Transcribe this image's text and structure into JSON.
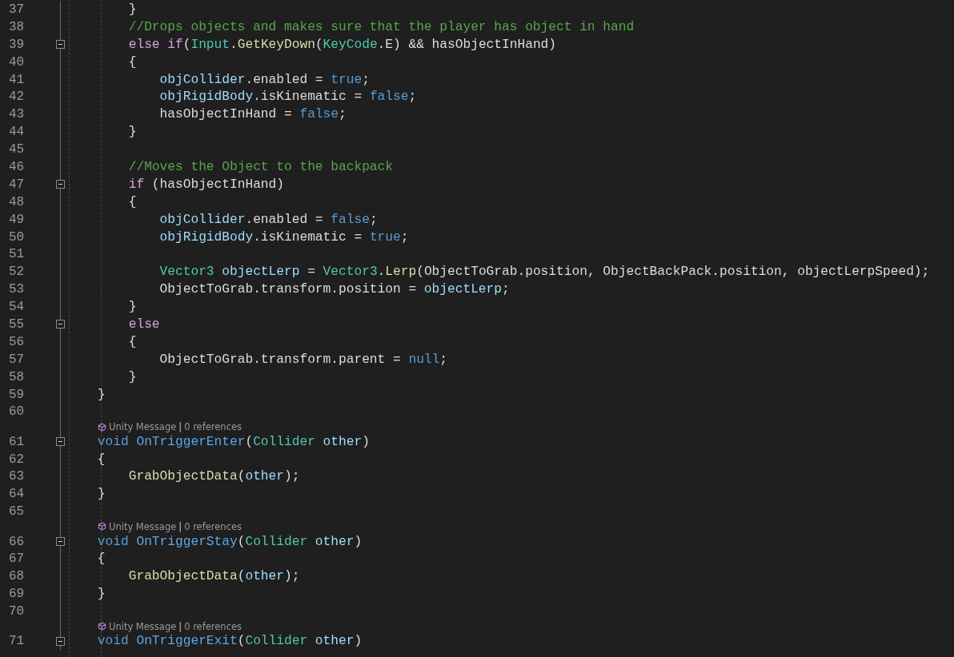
{
  "editor": {
    "lines": [
      {
        "kind": "code",
        "number": "37",
        "foldable": false,
        "tokens": [
          {
            "kind": "plain",
            "text": "        }"
          }
        ]
      },
      {
        "kind": "code",
        "number": "38",
        "foldable": false,
        "tokens": [
          {
            "kind": "comment",
            "text": "        //Drops objects and makes sure that the player has object in hand"
          }
        ]
      },
      {
        "kind": "code",
        "number": "39",
        "foldable": true,
        "tokens": [
          {
            "kind": "keyword",
            "text": "        else if"
          },
          {
            "kind": "plain",
            "text": "("
          },
          {
            "kind": "type",
            "text": "Input"
          },
          {
            "kind": "plain",
            "text": "."
          },
          {
            "kind": "method",
            "text": "GetKeyDown"
          },
          {
            "kind": "plain",
            "text": "("
          },
          {
            "kind": "type",
            "text": "KeyCode"
          },
          {
            "kind": "plain",
            "text": ".E) && hasObjectInHand)"
          }
        ]
      },
      {
        "kind": "code",
        "number": "40",
        "foldable": false,
        "tokens": [
          {
            "kind": "plain",
            "text": "        {"
          }
        ]
      },
      {
        "kind": "code",
        "number": "41",
        "foldable": false,
        "tokens": [
          {
            "kind": "local",
            "text": "            objCollider"
          },
          {
            "kind": "plain",
            "text": ".enabled = "
          },
          {
            "kind": "storage",
            "text": "true"
          },
          {
            "kind": "plain",
            "text": ";"
          }
        ]
      },
      {
        "kind": "code",
        "number": "42",
        "foldable": false,
        "tokens": [
          {
            "kind": "local",
            "text": "            objRigidBody"
          },
          {
            "kind": "plain",
            "text": ".isKinematic = "
          },
          {
            "kind": "storage",
            "text": "false"
          },
          {
            "kind": "plain",
            "text": ";"
          }
        ]
      },
      {
        "kind": "code",
        "number": "43",
        "foldable": false,
        "tokens": [
          {
            "kind": "plain",
            "text": "            hasObjectInHand = "
          },
          {
            "kind": "storage",
            "text": "false"
          },
          {
            "kind": "plain",
            "text": ";"
          }
        ]
      },
      {
        "kind": "code",
        "number": "44",
        "foldable": false,
        "tokens": [
          {
            "kind": "plain",
            "text": "        }"
          }
        ]
      },
      {
        "kind": "code",
        "number": "45",
        "foldable": false
      },
      {
        "kind": "code",
        "number": "46",
        "foldable": false,
        "tokens": [
          {
            "kind": "comment",
            "text": "        //Moves the Object to the backpack"
          }
        ]
      },
      {
        "kind": "code",
        "number": "47",
        "foldable": true,
        "tokens": [
          {
            "kind": "keyword",
            "text": "        if"
          },
          {
            "kind": "plain",
            "text": " (hasObjectInHand)"
          }
        ]
      },
      {
        "kind": "code",
        "number": "48",
        "foldable": false,
        "tokens": [
          {
            "kind": "plain",
            "text": "        {"
          }
        ]
      },
      {
        "kind": "code",
        "number": "49",
        "foldable": false,
        "tokens": [
          {
            "kind": "local",
            "text": "            objCollider"
          },
          {
            "kind": "plain",
            "text": ".enabled = "
          },
          {
            "kind": "storage",
            "text": "false"
          },
          {
            "kind": "plain",
            "text": ";"
          }
        ]
      },
      {
        "kind": "code",
        "number": "50",
        "foldable": false,
        "tokens": [
          {
            "kind": "local",
            "text": "            objRigidBody"
          },
          {
            "kind": "plain",
            "text": ".isKinematic = "
          },
          {
            "kind": "storage",
            "text": "true"
          },
          {
            "kind": "plain",
            "text": ";"
          }
        ]
      },
      {
        "kind": "code",
        "number": "51",
        "foldable": false
      },
      {
        "kind": "code",
        "number": "52",
        "foldable": false,
        "tokens": [
          {
            "kind": "type",
            "text": "            Vector3"
          },
          {
            "kind": "local",
            "text": " objectLerp"
          },
          {
            "kind": "plain",
            "text": " = "
          },
          {
            "kind": "type",
            "text": "Vector3"
          },
          {
            "kind": "plain",
            "text": "."
          },
          {
            "kind": "method",
            "text": "Lerp"
          },
          {
            "kind": "plain",
            "text": "(ObjectToGrab.position, ObjectBackPack.position, objectLerpSpeed);"
          }
        ]
      },
      {
        "kind": "code",
        "number": "53",
        "foldable": false,
        "tokens": [
          {
            "kind": "plain",
            "text": "            ObjectToGrab.transform.position = "
          },
          {
            "kind": "local",
            "text": "objectLerp"
          },
          {
            "kind": "plain",
            "text": ";"
          }
        ]
      },
      {
        "kind": "code",
        "number": "54",
        "foldable": false,
        "tokens": [
          {
            "kind": "plain",
            "text": "        }"
          }
        ]
      },
      {
        "kind": "code",
        "number": "55",
        "foldable": true,
        "tokens": [
          {
            "kind": "keyword",
            "text": "        else"
          }
        ]
      },
      {
        "kind": "code",
        "number": "56",
        "foldable": false,
        "tokens": [
          {
            "kind": "plain",
            "text": "        {"
          }
        ]
      },
      {
        "kind": "code",
        "number": "57",
        "foldable": false,
        "tokens": [
          {
            "kind": "plain",
            "text": "            ObjectToGrab.transform.parent = "
          },
          {
            "kind": "storage",
            "text": "null"
          },
          {
            "kind": "plain",
            "text": ";"
          }
        ]
      },
      {
        "kind": "code",
        "number": "58",
        "foldable": false,
        "tokens": [
          {
            "kind": "plain",
            "text": "        }"
          }
        ]
      },
      {
        "kind": "code",
        "number": "59",
        "foldable": false,
        "tokens": [
          {
            "kind": "plain",
            "text": "    }"
          }
        ]
      },
      {
        "kind": "code",
        "number": "60",
        "foldable": false
      },
      {
        "kind": "codelens",
        "label": "Unity Message",
        "separator": "|",
        "references": "0 references"
      },
      {
        "kind": "code",
        "number": "61",
        "foldable": true,
        "tokens": [
          {
            "kind": "storage",
            "text": "    void"
          },
          {
            "kind": "decl",
            "text": " OnTriggerEnter"
          },
          {
            "kind": "plain",
            "text": "("
          },
          {
            "kind": "type",
            "text": "Collider"
          },
          {
            "kind": "local",
            "text": " other"
          },
          {
            "kind": "plain",
            "text": ")"
          }
        ]
      },
      {
        "kind": "code",
        "number": "62",
        "foldable": false,
        "tokens": [
          {
            "kind": "plain",
            "text": "    {"
          }
        ]
      },
      {
        "kind": "code",
        "number": "63",
        "foldable": false,
        "tokens": [
          {
            "kind": "method",
            "text": "        GrabObjectData"
          },
          {
            "kind": "plain",
            "text": "("
          },
          {
            "kind": "local",
            "text": "other"
          },
          {
            "kind": "plain",
            "text": ");"
          }
        ]
      },
      {
        "kind": "code",
        "number": "64",
        "foldable": false,
        "tokens": [
          {
            "kind": "plain",
            "text": "    }"
          }
        ]
      },
      {
        "kind": "code",
        "number": "65",
        "foldable": false
      },
      {
        "kind": "codelens",
        "label": "Unity Message",
        "separator": "|",
        "references": "0 references"
      },
      {
        "kind": "code",
        "number": "66",
        "foldable": true,
        "tokens": [
          {
            "kind": "storage",
            "text": "    void"
          },
          {
            "kind": "decl",
            "text": " OnTriggerStay"
          },
          {
            "kind": "plain",
            "text": "("
          },
          {
            "kind": "type",
            "text": "Collider"
          },
          {
            "kind": "local",
            "text": " other"
          },
          {
            "kind": "plain",
            "text": ")"
          }
        ]
      },
      {
        "kind": "code",
        "number": "67",
        "foldable": false,
        "tokens": [
          {
            "kind": "plain",
            "text": "    {"
          }
        ]
      },
      {
        "kind": "code",
        "number": "68",
        "foldable": false,
        "tokens": [
          {
            "kind": "method",
            "text": "        GrabObjectData"
          },
          {
            "kind": "plain",
            "text": "("
          },
          {
            "kind": "local",
            "text": "other"
          },
          {
            "kind": "plain",
            "text": ");"
          }
        ]
      },
      {
        "kind": "code",
        "number": "69",
        "foldable": false,
        "tokens": [
          {
            "kind": "plain",
            "text": "    }"
          }
        ]
      },
      {
        "kind": "code",
        "number": "70",
        "foldable": false
      },
      {
        "kind": "codelens",
        "label": "Unity Message",
        "separator": "|",
        "references": "0 references"
      },
      {
        "kind": "code",
        "number": "71",
        "foldable": true,
        "tokens": [
          {
            "kind": "storage",
            "text": "    void"
          },
          {
            "kind": "decl",
            "text": " OnTriggerExit"
          },
          {
            "kind": "plain",
            "text": "("
          },
          {
            "kind": "type",
            "text": "Collider"
          },
          {
            "kind": "local",
            "text": " other"
          },
          {
            "kind": "plain",
            "text": ")"
          }
        ]
      }
    ]
  }
}
